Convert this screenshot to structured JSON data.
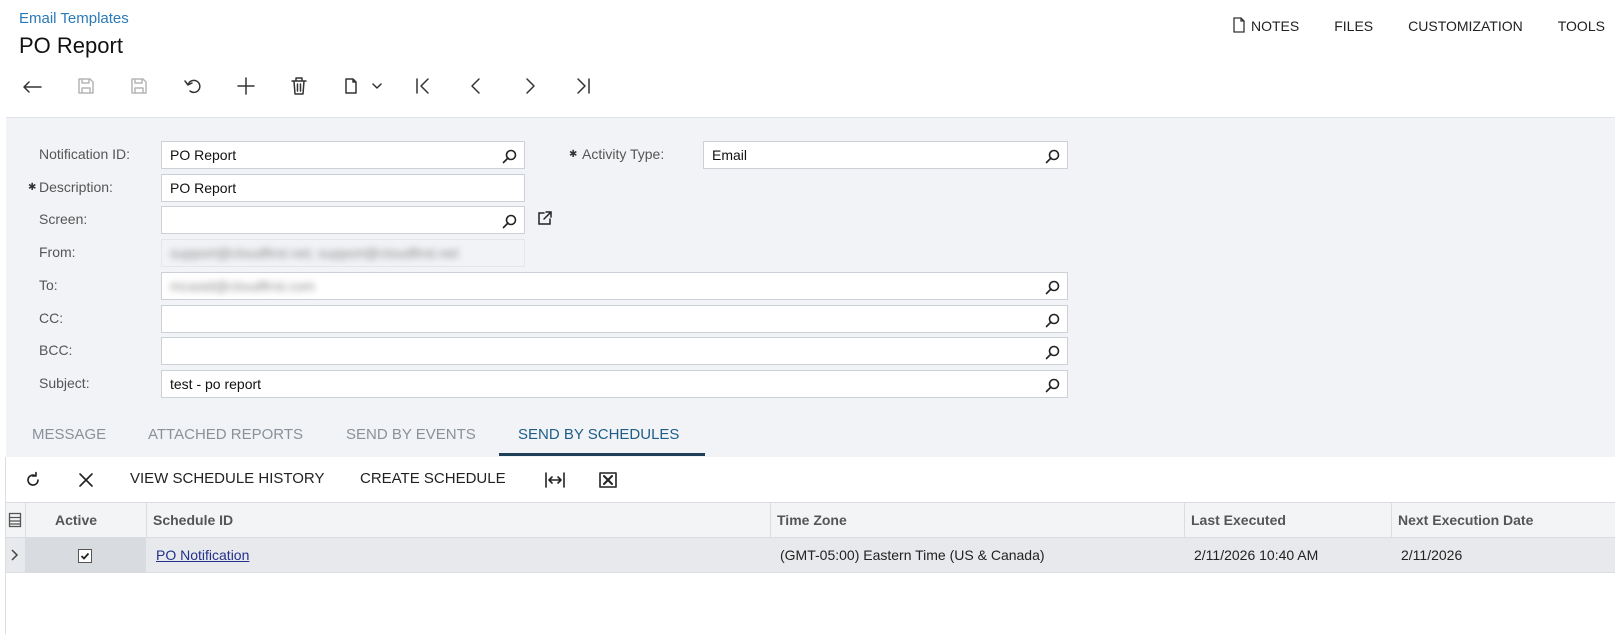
{
  "header": {
    "breadcrumb": "Email Templates",
    "title": "PO Report"
  },
  "top_links": {
    "notes": "NOTES",
    "files": "FILES",
    "customization": "CUSTOMIZATION",
    "tools": "TOOLS"
  },
  "toolbar": {
    "icons": [
      "back-icon",
      "save-close-icon",
      "save-icon",
      "undo-icon",
      "add-icon",
      "delete-icon",
      "copy-paste-icon",
      "first-record-icon",
      "previous-record-icon",
      "next-record-icon",
      "last-record-icon"
    ]
  },
  "form": {
    "notification_id": {
      "label": "Notification ID:",
      "value": "PO Report"
    },
    "activity_type": {
      "label": "Activity Type:",
      "value": "Email"
    },
    "description": {
      "label": "Description:",
      "value": "PO Report"
    },
    "screen": {
      "label": "Screen:",
      "value": ""
    },
    "from": {
      "label": "From:",
      "value": "support@cloudfirst.net; support@cloudfirst.net"
    },
    "to": {
      "label": "To:",
      "value": "mcasid@cloudfirst.com"
    },
    "cc": {
      "label": "CC:",
      "value": ""
    },
    "bcc": {
      "label": "BCC:",
      "value": ""
    },
    "subject": {
      "label": "Subject:",
      "value": "test - po report"
    }
  },
  "tabs": [
    {
      "label": "MESSAGE",
      "active": false
    },
    {
      "label": "ATTACHED REPORTS",
      "active": false
    },
    {
      "label": "SEND BY EVENTS",
      "active": false
    },
    {
      "label": "SEND BY SCHEDULES",
      "active": true
    }
  ],
  "grid_toolbar": {
    "view_history": "VIEW SCHEDULE HISTORY",
    "create_schedule": "CREATE SCHEDULE"
  },
  "grid": {
    "columns": [
      "Active",
      "Schedule ID",
      "Time Zone",
      "Last Executed",
      "Next Execution Date"
    ],
    "rows": [
      {
        "active": true,
        "schedule_id": "PO Notification",
        "time_zone": "(GMT-05:00) Eastern Time (US & Canada)",
        "last_executed": "2/11/2026 10:40 AM",
        "next_execution": "2/11/2026"
      }
    ]
  },
  "colors": {
    "accent": "#1f5d86",
    "link": "#23318c",
    "breadcrumb": "#2b7ab8",
    "form_bg": "#f1f3f6"
  }
}
